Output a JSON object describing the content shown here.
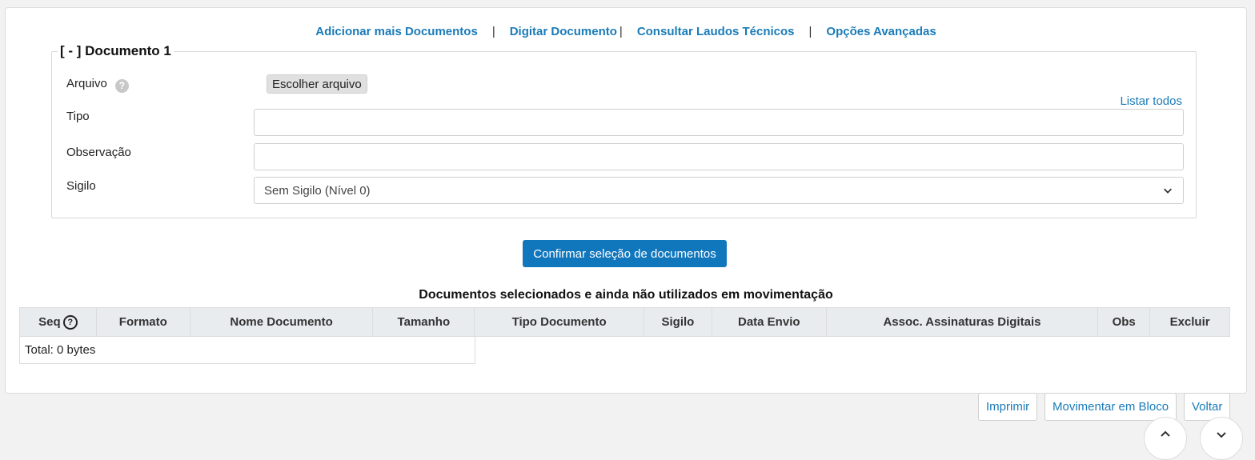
{
  "top_links": {
    "add_more": "Adicionar mais Documentos",
    "type_document": "Digitar Documento",
    "technical_reports": "Consultar Laudos Técnicos",
    "advanced_options": "Opções Avançadas",
    "separator": "|"
  },
  "document": {
    "legend": "[ - ] Documento 1",
    "file_label": "Arquivo",
    "help_glyph": "?",
    "choose_file": "Escolher arquivo",
    "list_all": "Listar todos",
    "type_label": "Tipo",
    "type_value": "",
    "observation_label": "Observação",
    "observation_value": "",
    "secrecy_label": "Sigilo",
    "secrecy_selected": "Sem Sigilo (Nível 0)"
  },
  "confirm_button": "Confirmar seleção de documentos",
  "table": {
    "title": "Documentos selecionados e ainda não utilizados em movimentação",
    "columns": [
      "Seq",
      "Formato",
      "Nome Documento",
      "Tamanho",
      "Tipo Documento",
      "Sigilo",
      "Data Envio",
      "Assoc. Assinaturas Digitais",
      "Obs",
      "Excluir"
    ],
    "total": "Total: 0 bytes"
  },
  "bottom_buttons": {
    "print": "Imprimir",
    "move_block": "Movimentar em Bloco",
    "back": "Voltar"
  },
  "colors": {
    "link": "#1a7bb8",
    "primary_button": "#1177bd",
    "table_header_bg": "#e9ecef"
  }
}
